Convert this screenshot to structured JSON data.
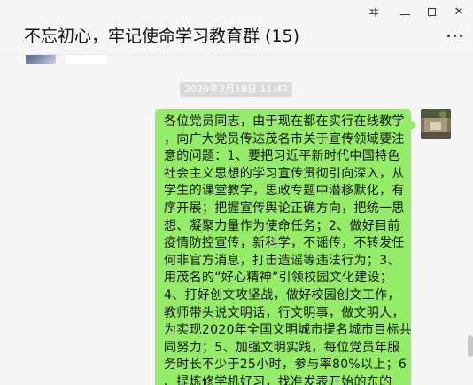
{
  "window": {
    "title": "不忘初心，牢记使命学习教育群 (15)",
    "pin_glyph": "ヰ",
    "close_glyph": "✕"
  },
  "chat": {
    "timestamp": "2020年3月18日 11:49",
    "message_lines": [
      "各位党员同志，由于现在都在实行在线教学",
      "，向广大党员传达茂名市关于宣传领域要注",
      "意的问题：1、要把习近平新时代中国特色",
      "社会主义思想的学习宣传贯彻引向深入，从",
      "学生的课堂教学，思政专题中潜移默化，有",
      "序开展；把握宣传舆论正确方向，把统一思",
      "想、凝聚力量作为使命任务；2、做好目前",
      "疫情防控宣传，新科学，不谣传，不转发任",
      "何非官方消息，打击造谣等违法行为；3、",
      "用茂名的“好心精神”引领校园文化建设；",
      "4、打好创文攻坚战，做好校园创文工作，",
      "教师带头说文明话，行文明事，做文明人，",
      "为实现2020年全国文明城市提名城市目标共",
      "同努力；5、加强文明实践，每位党员年服",
      "务时长不少于25小时，参与率80%以上；6",
      "、提炼修学机好习，找准发表开始的东的"
    ]
  },
  "colors": {
    "bubble": "#95ec69",
    "background": "#f5f5f5",
    "timestamp_bg": "#dadada"
  }
}
